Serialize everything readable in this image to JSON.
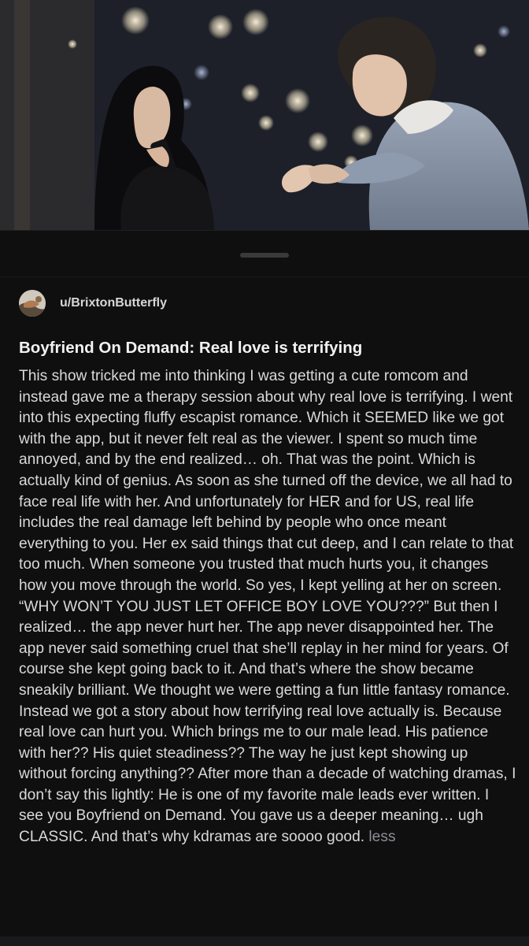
{
  "post": {
    "author": "u/BrixtonButterfly",
    "title": "Boyfriend On Demand: Real love is terrifying",
    "body": "This show tricked me into thinking I was getting a cute romcom and instead gave me a therapy session about why real love is terrifying. I went into this expecting fluffy escapist romance. Which it SEEMED like we got with the app, but it never felt real as the viewer. I spent so much time annoyed, and by the end realized… oh. That was the point. Which is actually kind of genius. As soon as she turned off the device, we all had to face real life with her. And unfortunately for HER and for US, real life includes the real damage left behind by people who once meant everything to you. Her ex said things that cut deep, and I can relate to that too much. When someone you trusted that much hurts you, it changes how you move through the world. So yes, I kept yelling at her on screen. “WHY WON’T YOU JUST LET OFFICE BOY LOVE YOU???” But then I realized… the app never hurt her. The app never disappointed her. The app never said something cruel that she’ll replay in her mind for years. Of course she kept going back to it. And that’s where the show became sneakily brilliant. We thought we were getting a fun little fantasy romance. Instead we got a story about how terrifying real love actually is. Because real love can hurt you. Which brings me to our male lead. His patience with her?? His quiet steadiness?? The way he just kept showing up without forcing anything?? After more than a decade of watching dramas, I don’t say this lightly: He is one of my favorite male leads ever written. I see you Boyfriend on Demand. You gave us a deeper meaning… ugh CLASSIC. And that’s why kdramas are soooo good.",
    "less_label": "less"
  },
  "theme": {
    "background": "#0f0f10",
    "text": "#d9d9db",
    "title": "#f2f2f3",
    "muted": "#8e8e93"
  }
}
